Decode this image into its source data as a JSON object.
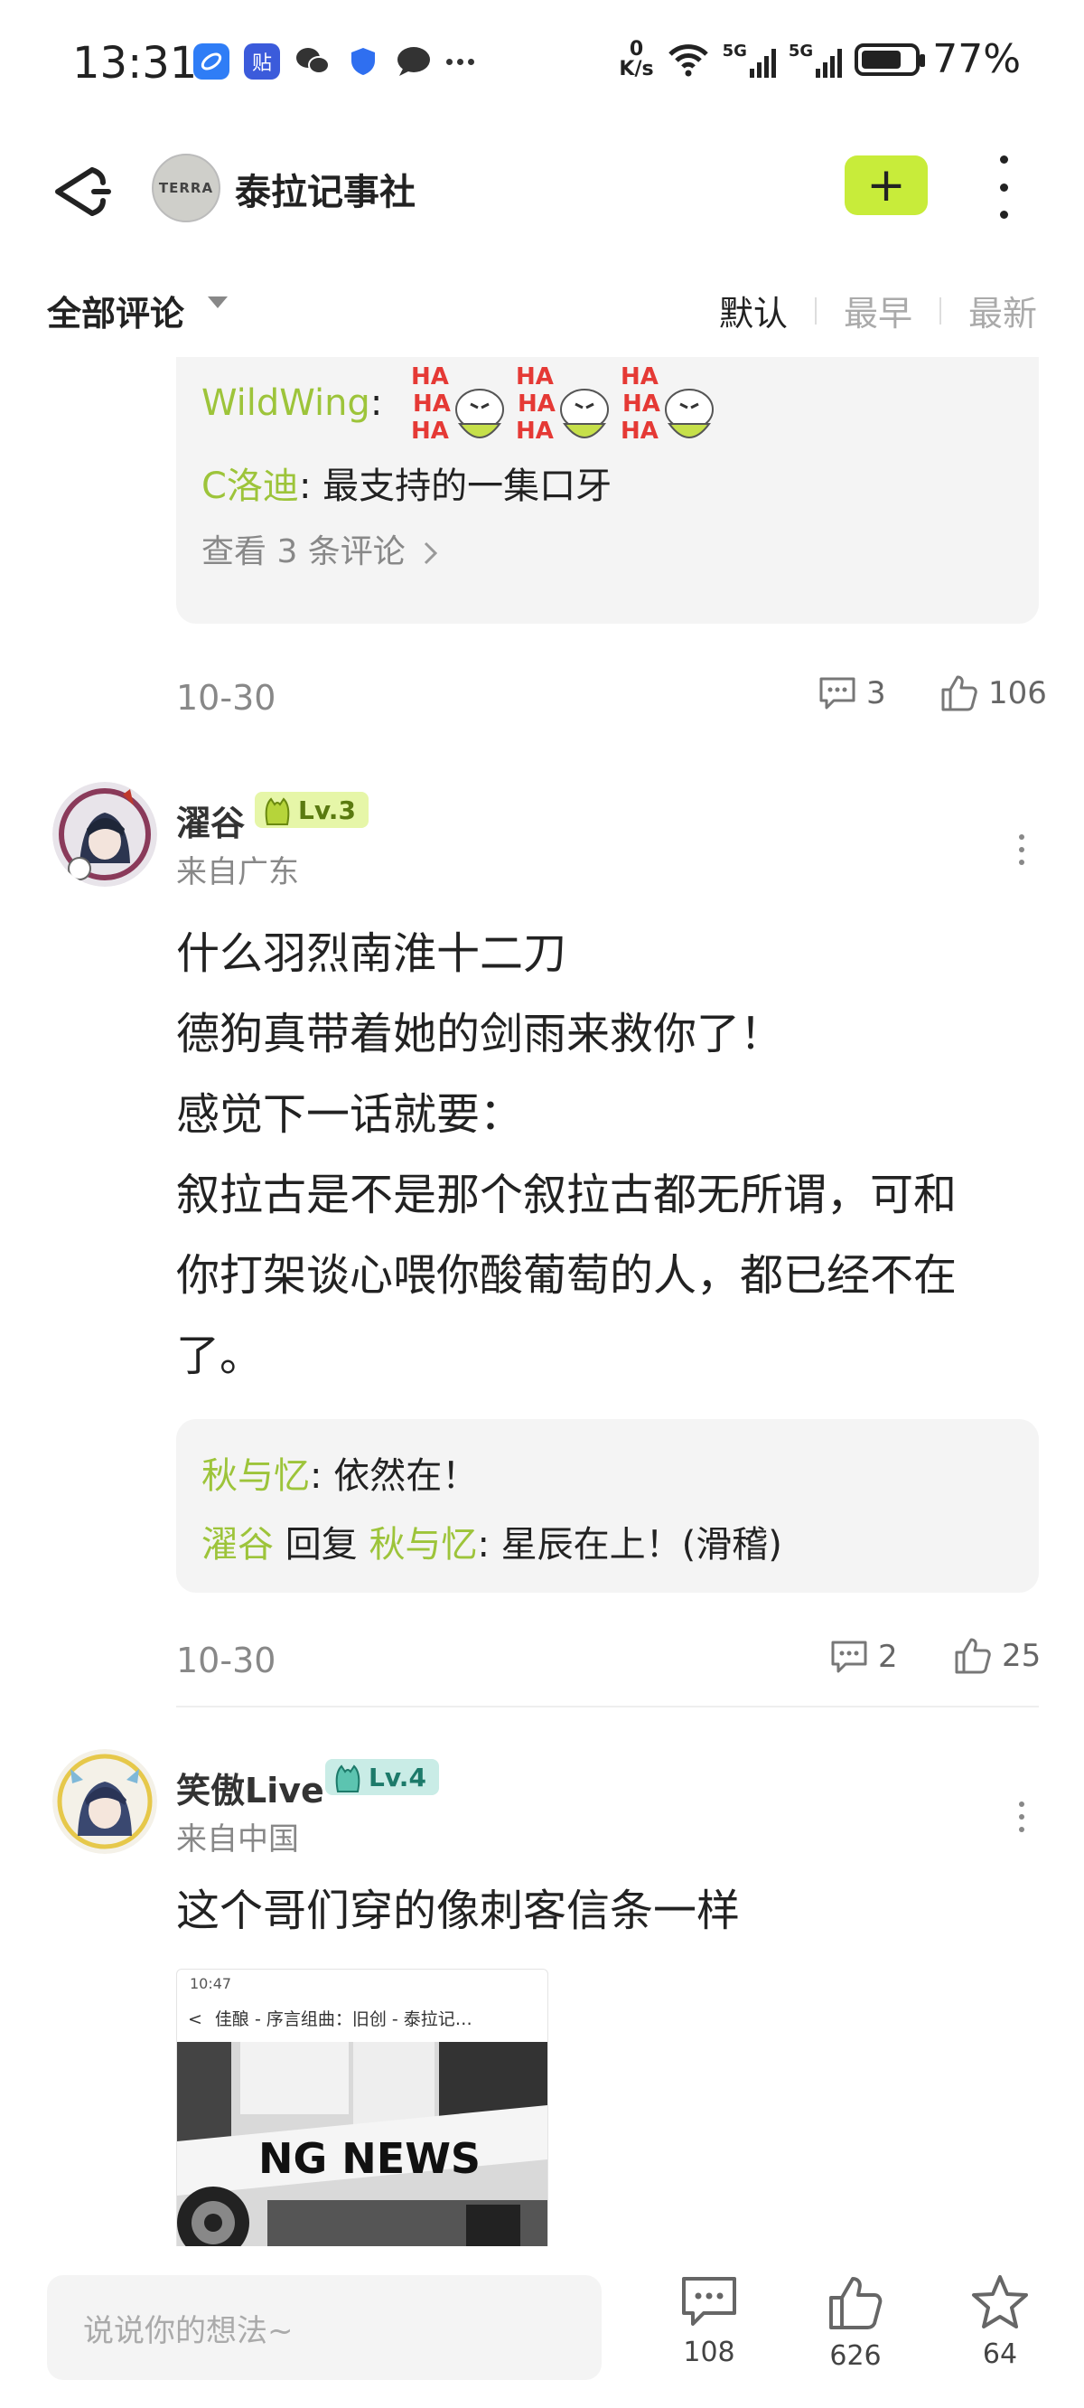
{
  "status_bar": {
    "time": "13:31",
    "net_speed_value": "0",
    "net_speed_unit": "K/s",
    "signal1": "5G",
    "signal2": "5G",
    "battery": "77%",
    "battery_level": 0.77,
    "app_icons": [
      "browser-app-icon",
      "tieba-app-icon",
      "wechat-app-icon",
      "shield-app-icon",
      "chat-app-icon",
      "more-dots-icon"
    ],
    "tieba_glyph": "贴"
  },
  "header": {
    "club_avatar_text": "TERRA",
    "club_name": "泰拉记事社",
    "follow_label": "+"
  },
  "sort": {
    "title": "全部评论",
    "options": [
      {
        "label": "默认",
        "active": true
      },
      {
        "label": "最早",
        "active": false
      },
      {
        "label": "最新",
        "active": false
      }
    ]
  },
  "comment0": {
    "replies": [
      {
        "user": "WildWing",
        "sep": ":",
        "text": ""
      },
      {
        "user": "C洛迪",
        "sep": ":",
        "text": " 最支持的一集口牙"
      }
    ],
    "sticker_text": "HA HA HA",
    "view_more": "查看 3 条评论",
    "date": "10-30",
    "comment_count": "3",
    "like_count": "106"
  },
  "comment1": {
    "username": "濯谷",
    "level": "Lv.3",
    "location": "来自广东",
    "body": [
      "什么羽烈南淮十二刀",
      "德狗真带着她的剑雨来救你了！",
      "感觉下一话就要：",
      "叙拉古是不是那个叙拉古都无所谓，可和",
      "你打架谈心喂你酸葡萄的人，都已经不在",
      "了。"
    ],
    "replies": {
      "r1_user": "秋与忆",
      "r1_text": ": 依然在！",
      "r2_user": "濯谷",
      "r2_mid": " 回复 ",
      "r2_target": "秋与忆",
      "r2_text": ": 星辰在上！(滑稽)"
    },
    "date": "10-30",
    "comment_count": "2",
    "like_count": "25"
  },
  "comment2": {
    "username": "笑傲Live",
    "level": "Lv.4",
    "location": "来自中国",
    "body": "这个哥们穿的像刺客信条一样",
    "image": {
      "time": "10:47",
      "title": "佳酿 - 序言组曲：旧创 - 泰拉记…",
      "newspaper_text": "NG NEWS"
    }
  },
  "bottom": {
    "placeholder": "说说你的想法~",
    "comments": "108",
    "likes": "626",
    "favorites": "64"
  },
  "colors": {
    "accent_green": "#c8ec3a",
    "username_green": "#9dc43a",
    "level3_bg": "#e6f6a8",
    "level4_bg": "#c9ece6"
  }
}
